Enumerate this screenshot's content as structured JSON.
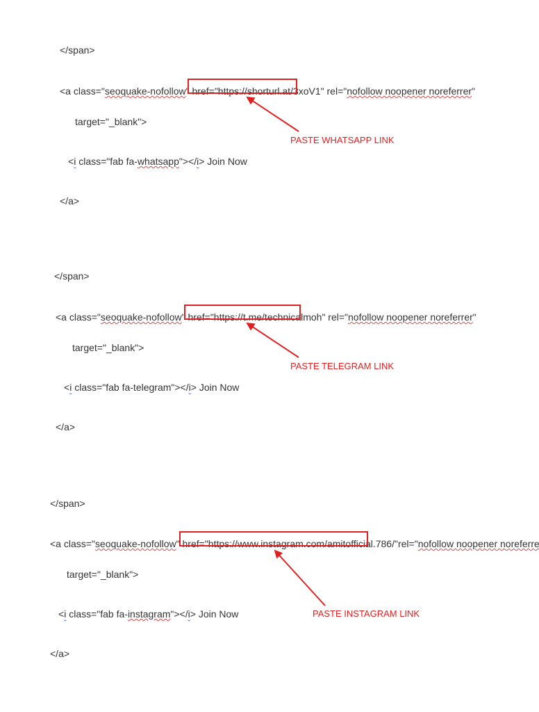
{
  "blocks": [
    {
      "close_span": "</span>",
      "a_open_pre": "<a class=\"",
      "a_class": "seoquake-nofollow",
      "a_href_pre": "\" href=\"",
      "href": "https://shorturl.at/3xoV1",
      "a_rel_pre": "\" rel=\"",
      "rel": "nofollow noopener noreferrer",
      "a_rel_post": "\"",
      "target_line": "target=\"_blank\">",
      "i_line_pre": "<i class=\"fab fa-",
      "icon_name": "whatsapp",
      "i_line_post": "\"></i> Join Now",
      "close_a": "</a>",
      "annotation": "PASTE WHATSAPP LINK"
    },
    {
      "close_span": "</span>",
      "a_open_pre": "<a class=\"",
      "a_class": "seoquake-nofollow",
      "a_href_pre": "\" href=\"",
      "href": "https://t.me/technicalmoh",
      "a_rel_pre": "\" rel=\"",
      "rel": "nofollow noopener noreferrer",
      "a_rel_post": "\"",
      "target_line": "target=\"_blank\">",
      "i_line_pre": "<i class=\"fab fa-",
      "icon_name": "telegram",
      "i_line_post": "\"></i> Join Now",
      "close_a": "</a>",
      "annotation": "PASTE TELEGRAM LINK"
    },
    {
      "close_span": "</span>",
      "a_open_pre": "<a class=\"",
      "a_class": "seoquake-nofollow",
      "a_href_pre": "\" href=\"",
      "href": "https://www.instagram.com/amitofficial.786/",
      "a_rel_pre": "\" rel=\"",
      "rel": "nofollow noopener noreferrer",
      "a_rel_post": "\"",
      "target_line": "target=\"_blank\">",
      "i_line_pre": "<i class=\"fab fa-",
      "icon_name": "instagram",
      "i_line_post": "\"></i> Join Now",
      "close_a": "</a>",
      "annotation": "PASTE INSTAGRAM LINK"
    }
  ]
}
